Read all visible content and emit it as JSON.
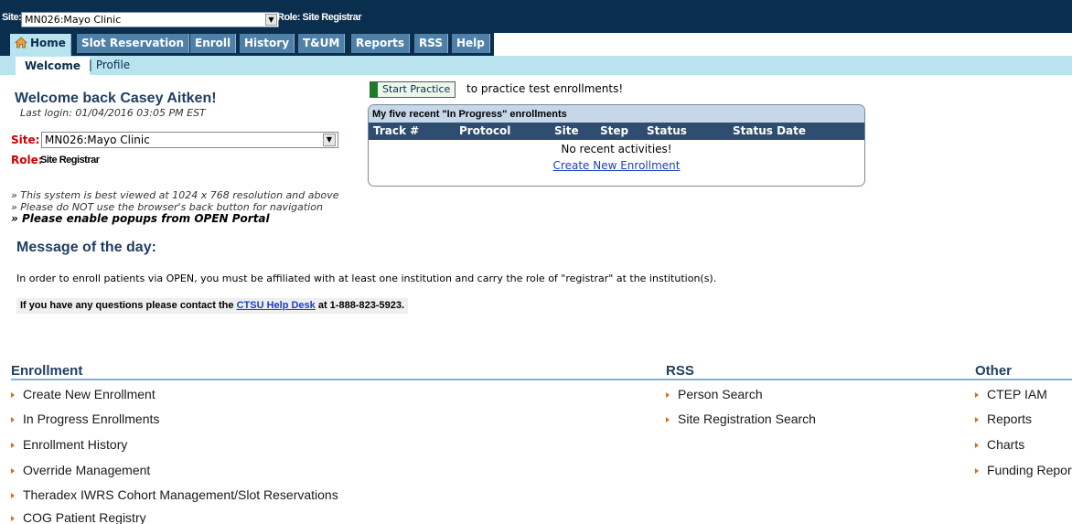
{
  "topbar": {
    "site_label": "Site:",
    "site_value": "MN026:Mayo Clinic",
    "role_text": "Role: Site Registrar"
  },
  "tabs": [
    {
      "label": "Home",
      "active": true
    },
    {
      "label": "Slot Reservation"
    },
    {
      "label": "Enroll"
    },
    {
      "label": "History"
    },
    {
      "label": "T&UM"
    },
    {
      "label": "Reports"
    },
    {
      "label": "RSS"
    },
    {
      "label": "Help"
    }
  ],
  "subnav": {
    "welcome": "Welcome",
    "profile": "| Profile"
  },
  "welcome": {
    "title": "Welcome back Casey Aitken!",
    "last_login": "Last login: 01/04/2016 03:05 PM EST",
    "site_label": "Site:",
    "site_value": "MN026:Mayo Clinic",
    "role_label": "Role:",
    "role_value": "Site Registrar"
  },
  "notes": {
    "line1": "» This system is best viewed at 1024 x 768 resolution and above",
    "line2": "» Please do NOT use the browser's back button for navigation",
    "line3": "» Please enable popups from OPEN Portal"
  },
  "practice": {
    "button": "Start Practice",
    "text": "to practice test enrollments!"
  },
  "recent": {
    "title": "My five recent \"In Progress\" enrollments",
    "columns": [
      "Track #",
      "Protocol",
      "Site",
      "Step",
      "Status",
      "Status Date"
    ],
    "empty": "No recent activities!",
    "create_link": "Create New Enrollment"
  },
  "motd": {
    "title": "Message of the day:",
    "text": "In order to enroll patients via OPEN, you must be affiliated with at least one institution and carry the role of \"registrar\" at the institution(s).",
    "help_prefix": "If you have any questions please contact the ",
    "help_link": "CTSU Help Desk",
    "help_suffix": " at 1-888-823-5923."
  },
  "sections": {
    "enrollment": {
      "title": "Enrollment",
      "items": [
        "Create New Enrollment",
        "In Progress Enrollments",
        "Enrollment History",
        "Override Management",
        "Theradex IWRS Cohort Management/Slot Reservations",
        "COG Patient Registry"
      ]
    },
    "rss": {
      "title": "RSS",
      "items": [
        "Person Search",
        "Site Registration Search"
      ]
    },
    "other": {
      "title": "Other",
      "items": [
        "CTEP IAM",
        "Reports",
        "Charts",
        "Funding Report"
      ]
    }
  },
  "colors": {
    "header_navy": "#0a2e4e",
    "tab_blue": "#4f81a8",
    "light_cyan": "#b9e3ef",
    "label_red": "#cc0000",
    "bullet_orange": "#e06a1a"
  }
}
